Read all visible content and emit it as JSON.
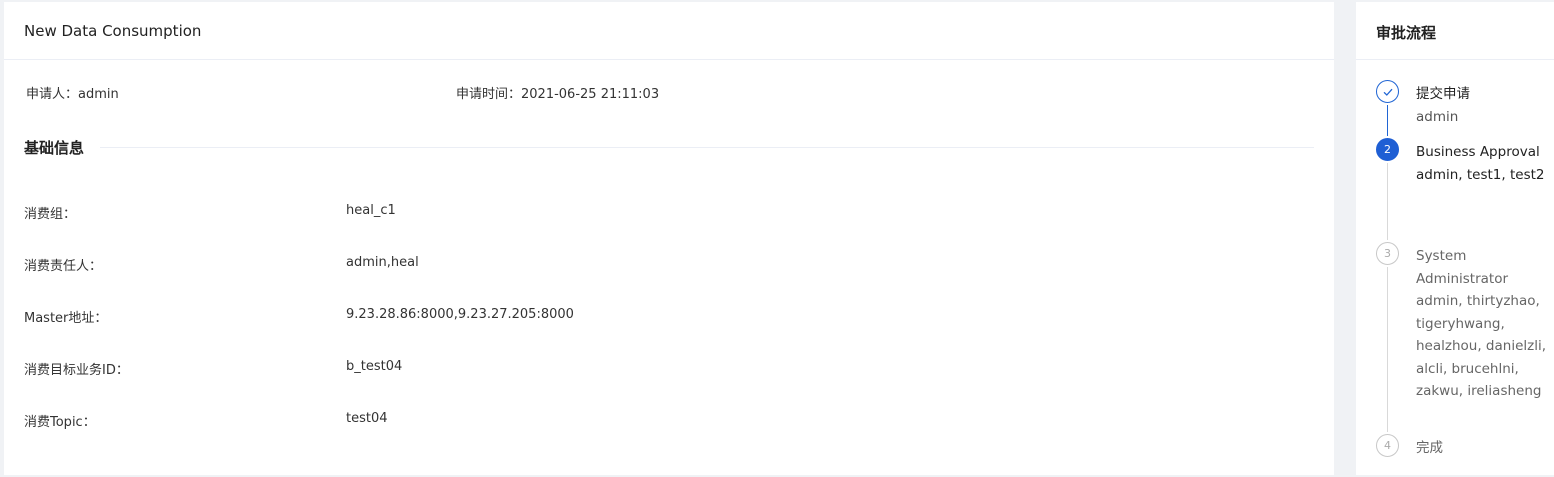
{
  "main": {
    "title": "New Data Consumption",
    "applicant_label": "申请人：",
    "applicant_value": "admin",
    "apply_time_label": "申请时间：",
    "apply_time_value": "2021-06-25 21:11:03",
    "section_title": "基础信息",
    "fields": [
      {
        "label": "消费组：",
        "value": "heal_c1"
      },
      {
        "label": "消费责任人：",
        "value": "admin,heal"
      },
      {
        "label": "Master地址：",
        "value": "9.23.28.86:8000,9.23.27.205:8000"
      },
      {
        "label": "消费目标业务ID：",
        "value": "b_test04"
      },
      {
        "label": "消费Topic：",
        "value": "test04"
      }
    ]
  },
  "side": {
    "title": "审批流程",
    "steps": [
      {
        "status": "done",
        "icon": "check-icon",
        "number": "",
        "title": "提交申请",
        "desc": "admin"
      },
      {
        "status": "active",
        "icon": "",
        "number": "2",
        "title": "Business Approval",
        "desc": "admin, test1, test2"
      },
      {
        "status": "wait",
        "icon": "",
        "number": "3",
        "title": "System Administrator",
        "desc": "admin, thirtyzhao, tigeryhwang, healzhou, danielzli, alcli, brucehlni, zakwu, ireliasheng"
      },
      {
        "status": "wait",
        "icon": "",
        "number": "4",
        "title": "完成",
        "desc": ""
      }
    ]
  },
  "colors": {
    "accent": "#1f5fd4",
    "background": "#f0f2f5",
    "panel": "#ffffff"
  }
}
